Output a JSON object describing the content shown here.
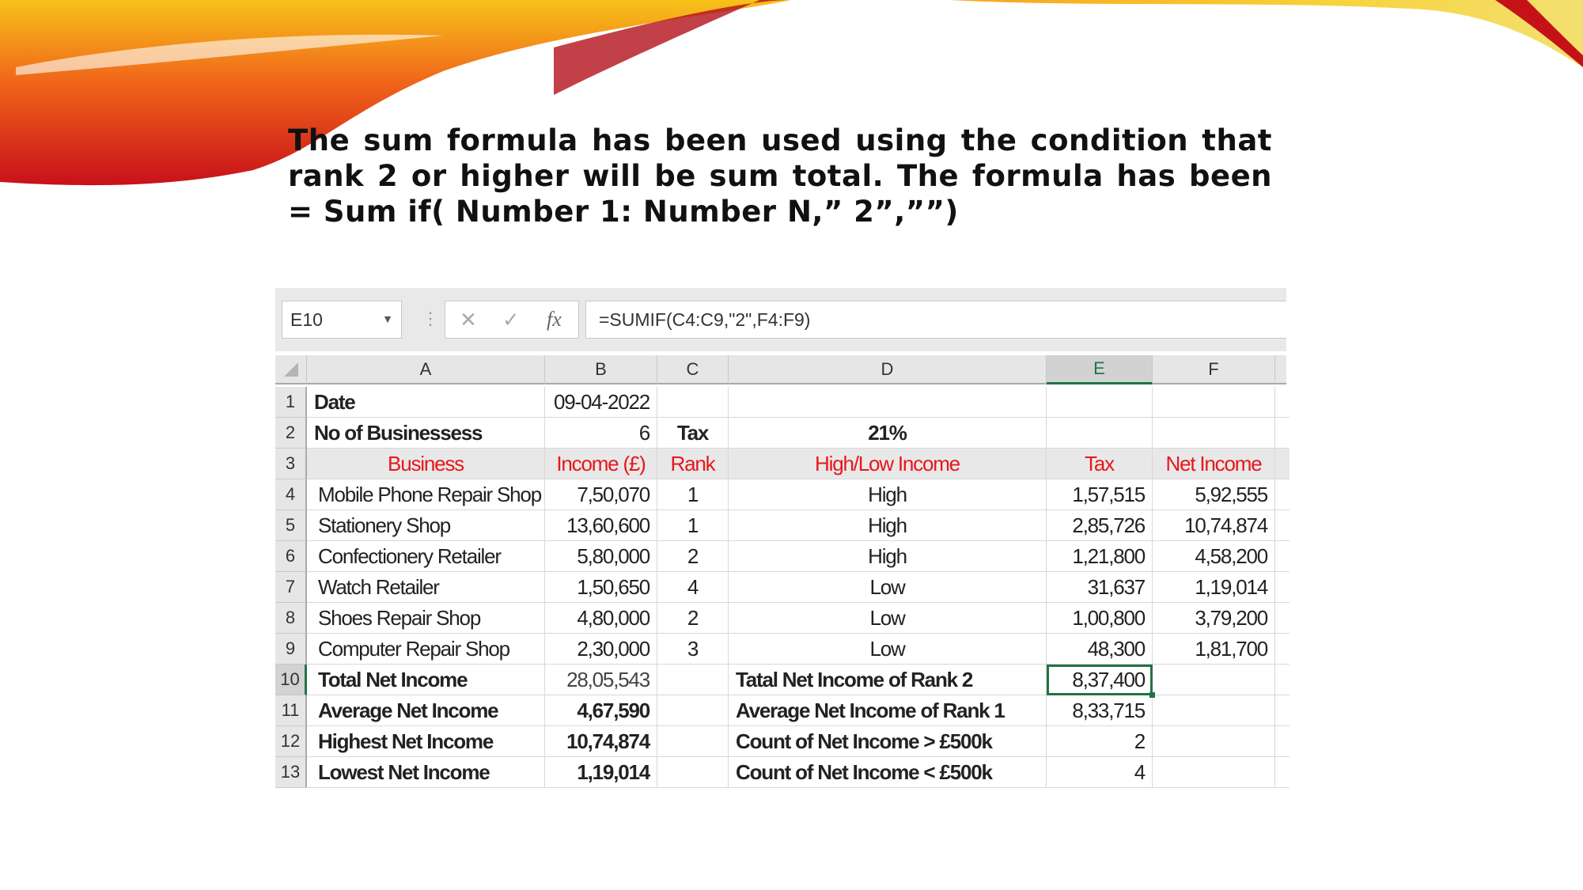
{
  "slide": {
    "title": "The sum formula has been used using the condition that rank 2 or higher will be sum total. The formula has been = Sum if( Number 1: Number N,” 2”,””)"
  },
  "formula_bar": {
    "name_box": "E10",
    "cancel_icon": "✕",
    "enter_icon": "✓",
    "fx_label": "fx",
    "formula": "=SUMIF(C4:C9,\"2\",F4:F9)"
  },
  "sheet": {
    "selected_cell": "E10",
    "header_color": "#e8161b",
    "selection_color": "#217346",
    "columns": [
      "A",
      "B",
      "C",
      "D",
      "E",
      "F"
    ],
    "rows": [
      {
        "num": "1",
        "cells": [
          "Date",
          "09-04-2022",
          "",
          "",
          "",
          ""
        ]
      },
      {
        "num": "2",
        "cells": [
          "No of Businessess",
          "6",
          "Tax",
          "21%",
          "",
          ""
        ]
      },
      {
        "num": "3",
        "cells": [
          "Business",
          "Income (£)",
          "Rank",
          "High/Low Income",
          "Tax",
          "Net Income"
        ]
      },
      {
        "num": "4",
        "cells": [
          "Mobile Phone Repair Shop",
          "7,50,070",
          "1",
          "High",
          "1,57,515",
          "5,92,555"
        ]
      },
      {
        "num": "5",
        "cells": [
          "Stationery Shop",
          "13,60,600",
          "1",
          "High",
          "2,85,726",
          "10,74,874"
        ]
      },
      {
        "num": "6",
        "cells": [
          "Confectionery Retailer",
          "5,80,000",
          "2",
          "High",
          "1,21,800",
          "4,58,200"
        ]
      },
      {
        "num": "7",
        "cells": [
          "Watch Retailer",
          "1,50,650",
          "4",
          "Low",
          "31,637",
          "1,19,014"
        ]
      },
      {
        "num": "8",
        "cells": [
          "Shoes Repair Shop",
          "4,80,000",
          "2",
          "Low",
          "1,00,800",
          "3,79,200"
        ]
      },
      {
        "num": "9",
        "cells": [
          "Computer Repair Shop",
          "2,30,000",
          "3",
          "Low",
          "48,300",
          "1,81,700"
        ]
      },
      {
        "num": "10",
        "cells": [
          "Total Net Income",
          "28,05,543",
          "",
          "Tatal Net Income of Rank 2",
          "8,37,400",
          ""
        ]
      },
      {
        "num": "11",
        "cells": [
          "Average Net Income",
          "4,67,590",
          "",
          "Average Net Income of Rank 1",
          "8,33,715",
          ""
        ]
      },
      {
        "num": "12",
        "cells": [
          "Highest Net Income",
          "10,74,874",
          "",
          "Count of Net Income > £500k",
          "2",
          ""
        ]
      },
      {
        "num": "13",
        "cells": [
          "Lowest Net Income",
          "1,19,014",
          "",
          "Count of Net Income < £500k",
          "4",
          ""
        ]
      }
    ]
  }
}
